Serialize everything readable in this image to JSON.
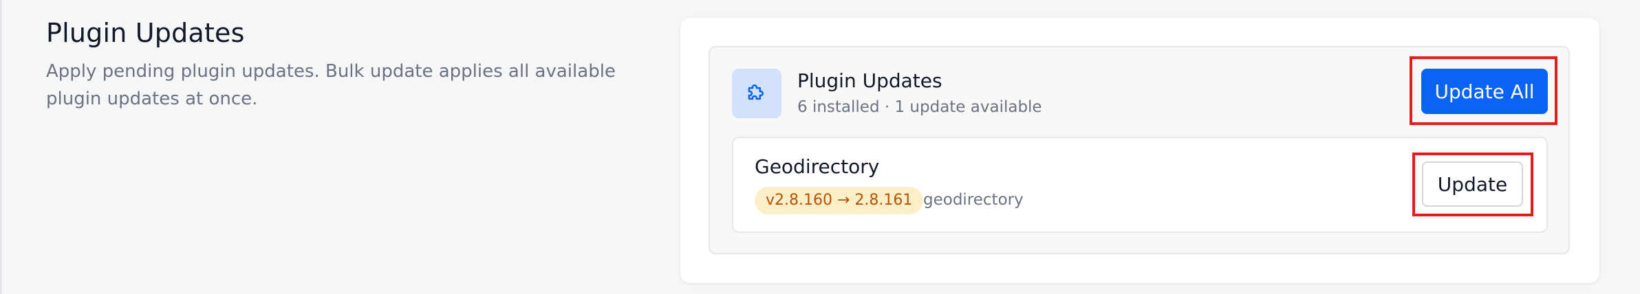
{
  "section": {
    "title": "Plugin Updates",
    "description": "Apply pending plugin updates. Bulk update applies all available plugin updates at once."
  },
  "panel": {
    "icon": "puzzle-piece-icon",
    "title": "Plugin Updates",
    "subtitle": "6 installed · 1 update available",
    "update_all_label": "Update All"
  },
  "plugins": [
    {
      "name": "Geodirectory",
      "version_change": "v2.8.160 → 2.8.161",
      "slug": "geodirectory",
      "update_label": "Update"
    }
  ],
  "colors": {
    "accent": "#0b63f6",
    "highlight": "#e51c1c",
    "badge_bg": "#fcefc7",
    "badge_text": "#b45309",
    "icon_bg": "#d3e2fb"
  }
}
